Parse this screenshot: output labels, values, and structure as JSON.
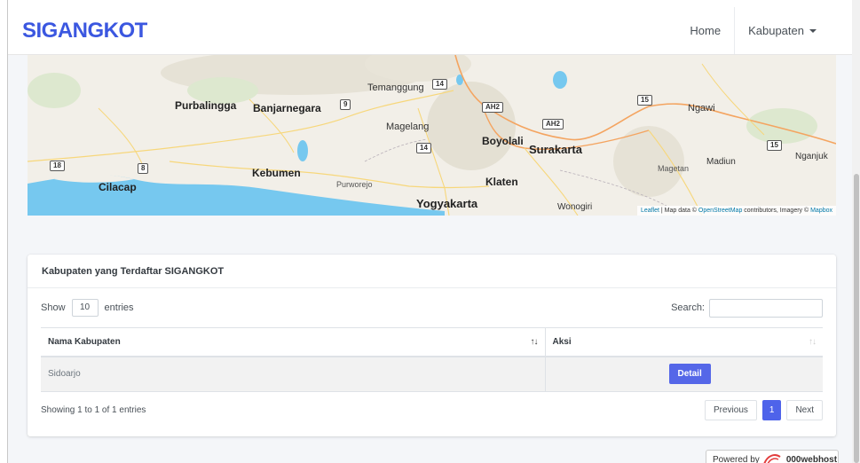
{
  "navbar": {
    "brand": "SIGANGKOT",
    "home": "Home",
    "kabupaten": "Kabupaten"
  },
  "map": {
    "labels": {
      "purbalingga": "Purbalingga",
      "banjarnegara": "Banjarnegara",
      "temanggung": "Temanggung",
      "magelang": "Magelang",
      "boyolali": "Boyolali",
      "surakarta": "Surakarta",
      "ngawi": "Ngawi",
      "madiun": "Madiun",
      "magetan": "Magetan",
      "nganjuk": "Nganjuk",
      "cilacap": "Cilacap",
      "kebumen": "Kebumen",
      "purworejo": "Purworejo",
      "klaten": "Klaten",
      "yogyakarta": "Yogyakarta",
      "wonogiri": "Wonogiri"
    },
    "shields": {
      "s14a": "14",
      "s9": "9",
      "ah2a": "AH2",
      "ah2b": "AH2",
      "s14b": "14",
      "s15a": "15",
      "s15b": "15",
      "s18": "18",
      "s8": "8"
    },
    "attribution": {
      "leaflet": "Leaflet",
      "sep": " | Map data © ",
      "osm": "OpenStreetMap",
      "mid": " contributors, Imagery © ",
      "mapbox": "Mapbox"
    }
  },
  "card": {
    "title": "Kabupaten yang Terdaftar SIGANGKOT",
    "show_label": "Show",
    "entries_value": "10",
    "entries_label": "entries",
    "search_label": "Search:",
    "columns": [
      "Nama Kabupaten",
      "Aksi"
    ],
    "rows": [
      {
        "name": "Sidoarjo",
        "action": "Detail"
      }
    ],
    "info": "Showing 1 to 1 of 1 entries",
    "pager": {
      "previous": "Previous",
      "current": "1",
      "next": "Next"
    }
  },
  "footer": {
    "powered_by": "Powered by",
    "host": "000webhost"
  },
  "colors": {
    "brand": "#3b57e0",
    "primary_button": "#5567e8",
    "sea": "#76c8ef",
    "land": "#f2efe8"
  }
}
